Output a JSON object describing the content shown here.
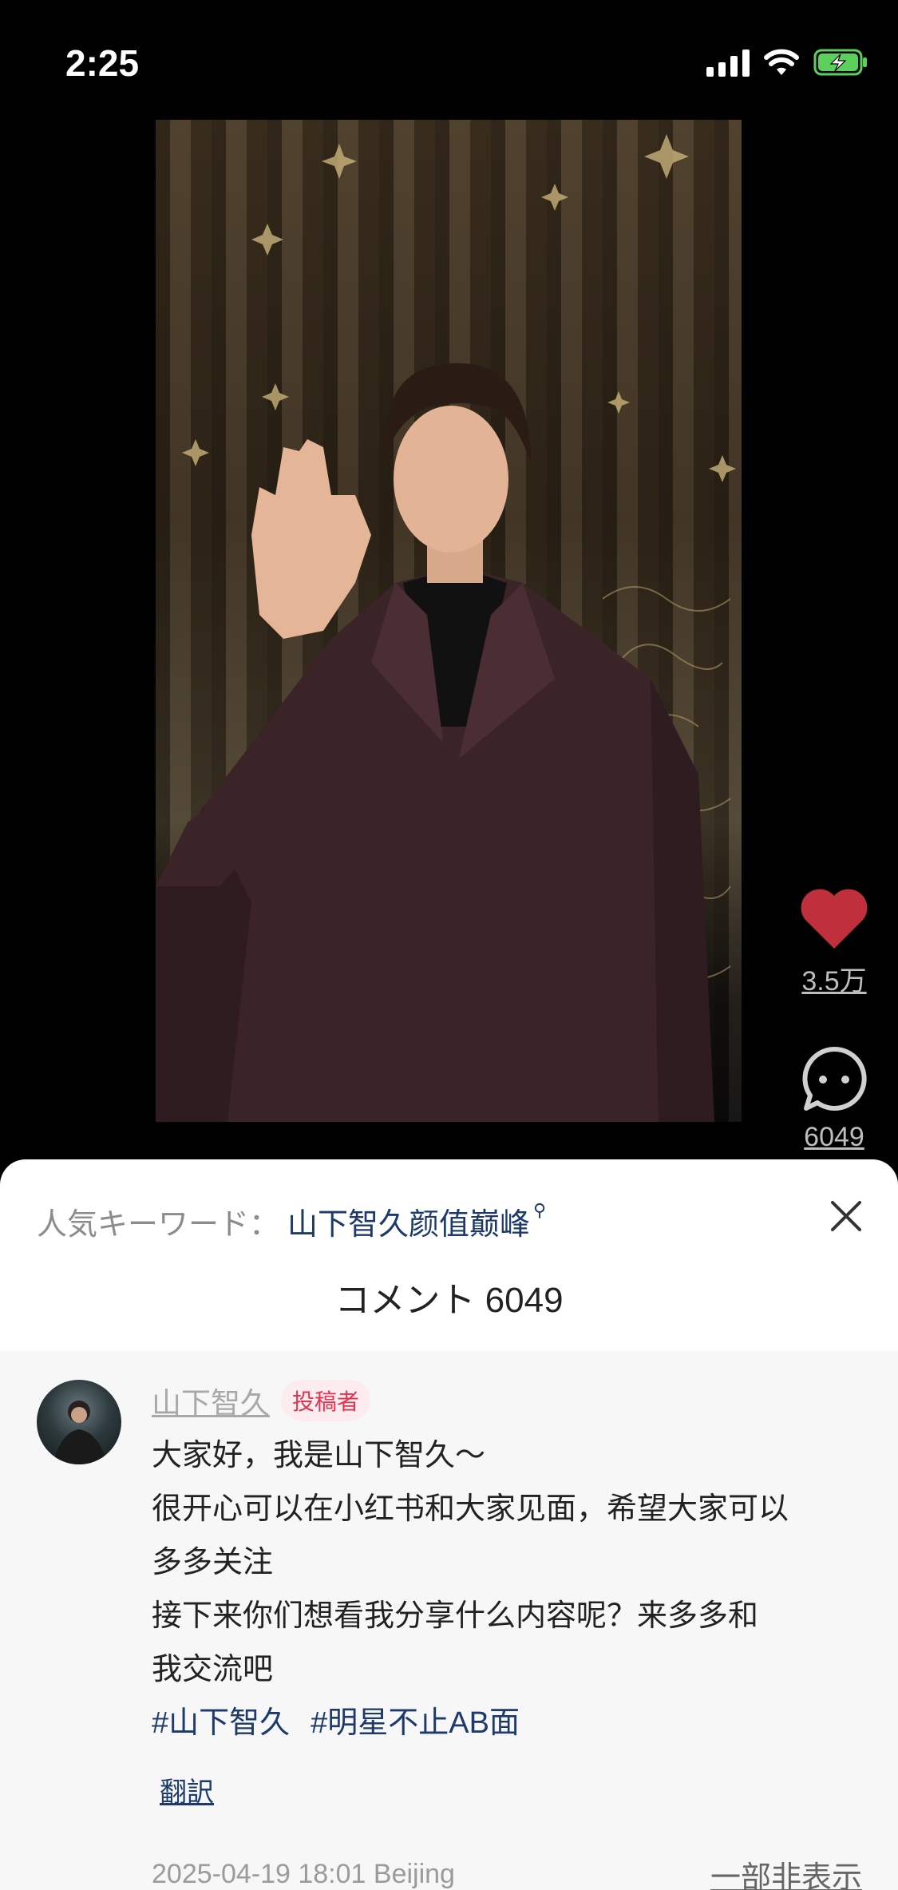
{
  "status_bar": {
    "time": "2:25"
  },
  "post": {
    "like_count": "3.5万",
    "comment_count": "6049"
  },
  "sheet": {
    "keyword_label": "人気キーワード：",
    "keyword_link": "山下智久颜值巅峰",
    "title": "コメント 6049"
  },
  "comment": {
    "author": "山下智久",
    "badge": "投稿者",
    "lines": [
      "大家好，我是山下智久～",
      "很开心可以在小红书和大家见面，希望大家可以",
      "多多关注",
      "接下来你们想看我分享什么内容呢？来多多和",
      "我交流吧"
    ],
    "hashtags": [
      "#山下智久",
      "#明星不止AB面"
    ],
    "translate": "翻訳",
    "timestamp": "2025-04-19 18:01 Beijing",
    "hide": "一部非表示"
  },
  "colors": {
    "like": "#c0303c",
    "link": "#1e3a6b",
    "badge_text": "#e0344f",
    "badge_bg": "#fdecef"
  }
}
